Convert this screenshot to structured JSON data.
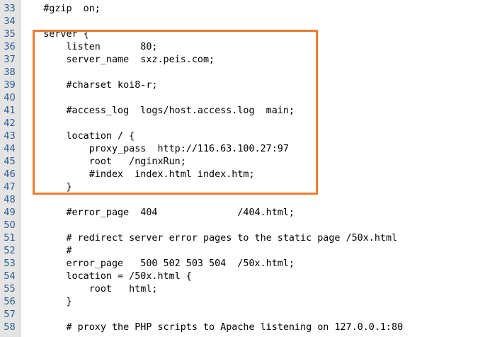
{
  "editor": {
    "lines": [
      {
        "no": "33",
        "text": "    #gzip  on;"
      },
      {
        "no": "34",
        "text": ""
      },
      {
        "no": "35",
        "text": "    server {"
      },
      {
        "no": "36",
        "text": "        listen       80;"
      },
      {
        "no": "37",
        "text": "        server_name  sxz.peis.com;"
      },
      {
        "no": "38",
        "text": ""
      },
      {
        "no": "39",
        "text": "        #charset koi8-r;"
      },
      {
        "no": "40",
        "text": ""
      },
      {
        "no": "41",
        "text": "        #access_log  logs/host.access.log  main;"
      },
      {
        "no": "42",
        "text": ""
      },
      {
        "no": "43",
        "text": "        location / {"
      },
      {
        "no": "44",
        "text": "            proxy_pass  http://116.63.100.27:97"
      },
      {
        "no": "45",
        "text": "            root   /nginxRun;"
      },
      {
        "no": "46",
        "text": "            #index  index.html index.htm;"
      },
      {
        "no": "47",
        "text": "        }"
      },
      {
        "no": "48",
        "text": ""
      },
      {
        "no": "49",
        "text": "        #error_page  404              /404.html;"
      },
      {
        "no": "50",
        "text": ""
      },
      {
        "no": "51",
        "text": "        # redirect server error pages to the static page /50x.html"
      },
      {
        "no": "52",
        "text": "        #"
      },
      {
        "no": "53",
        "text": "        error_page   500 502 503 504  /50x.html;"
      },
      {
        "no": "54",
        "text": "        location = /50x.html {"
      },
      {
        "no": "55",
        "text": "            root   html;"
      },
      {
        "no": "56",
        "text": "        }"
      },
      {
        "no": "57",
        "text": ""
      },
      {
        "no": "58",
        "text": "        # proxy the PHP scripts to Apache listening on 127.0.0.1:80"
      }
    ]
  },
  "highlight": {
    "color": "#ed7d31"
  },
  "colors": {
    "gutter_bg": "#e4e4e4",
    "line_number": "#2b5d91",
    "text": "#000000"
  }
}
